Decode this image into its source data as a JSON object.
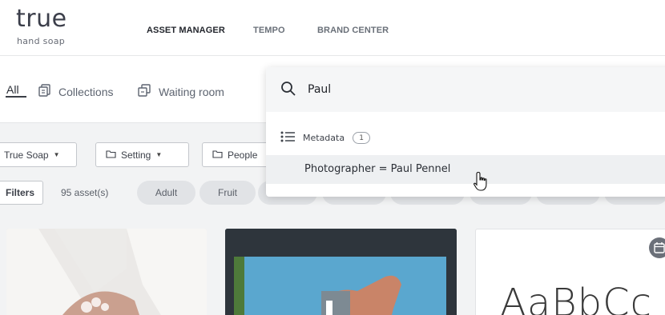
{
  "header": {
    "logo": {
      "word": "true",
      "sub": "hand soap"
    },
    "nav": [
      {
        "label": "ASSET MANAGER",
        "active": true
      },
      {
        "label": "TEMPO",
        "active": false
      },
      {
        "label": "BRAND CENTER",
        "active": false
      }
    ]
  },
  "tabs": [
    {
      "label": "All",
      "active": true
    },
    {
      "label": "Collections",
      "icon": "collections-icon"
    },
    {
      "label": "Waiting room",
      "icon": "waiting-room-icon"
    }
  ],
  "filters": {
    "buttons": [
      {
        "label": "True Soap",
        "icon": "none"
      },
      {
        "label": "Setting",
        "icon": "folder-icon"
      },
      {
        "label": "People",
        "icon": "folder-icon"
      }
    ],
    "filters_label": "Filters",
    "asset_count": "95 asset(s)",
    "tags": [
      "Adult",
      "Fruit",
      "",
      "",
      "",
      "",
      "",
      ""
    ]
  },
  "cards": [
    {
      "type": "photo",
      "description": "hands-washing"
    },
    {
      "type": "photo",
      "description": "hand-holding-card"
    },
    {
      "type": "typography",
      "sample": "AaBbCc"
    }
  ],
  "search": {
    "value": "Paul",
    "group_label": "Metadata",
    "group_count": "1",
    "result": "Photographer = Paul Pennel"
  },
  "colors": {
    "header_bg": "#ffffff",
    "page_bg": "#f2f3f4",
    "tag_bg": "#e1e3e6",
    "card_dark": "#2e353c",
    "accent_green": "#4e7a3a",
    "photo_blue": "#5aa7cf"
  }
}
